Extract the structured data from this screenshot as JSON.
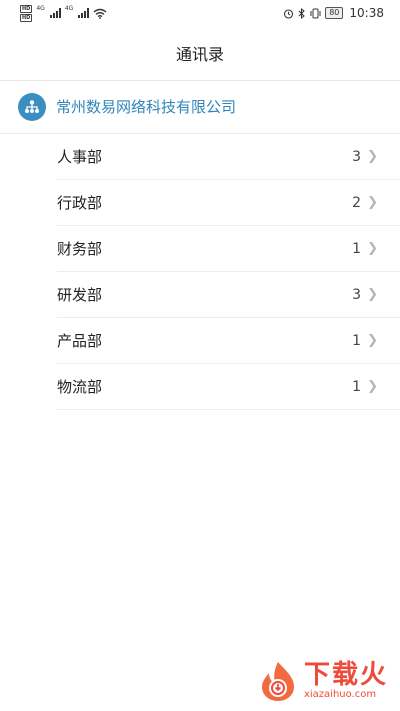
{
  "status_bar": {
    "hd_label": "HD",
    "network_label_1": "4G",
    "network_label_2": "4G",
    "battery": "80",
    "time": "10:38"
  },
  "header": {
    "title": "通讯录"
  },
  "company": {
    "name": "常州数易网络科技有限公司",
    "icon": "org-chart-icon",
    "color": "#2f86b9"
  },
  "departments": [
    {
      "name": "人事部",
      "count": "3"
    },
    {
      "name": "行政部",
      "count": "2"
    },
    {
      "name": "财务部",
      "count": "1"
    },
    {
      "name": "研发部",
      "count": "3"
    },
    {
      "name": "产品部",
      "count": "1"
    },
    {
      "name": "物流部",
      "count": "1"
    }
  ],
  "watermark": {
    "cn": "下载火",
    "en": "xiazaihuo.com"
  }
}
